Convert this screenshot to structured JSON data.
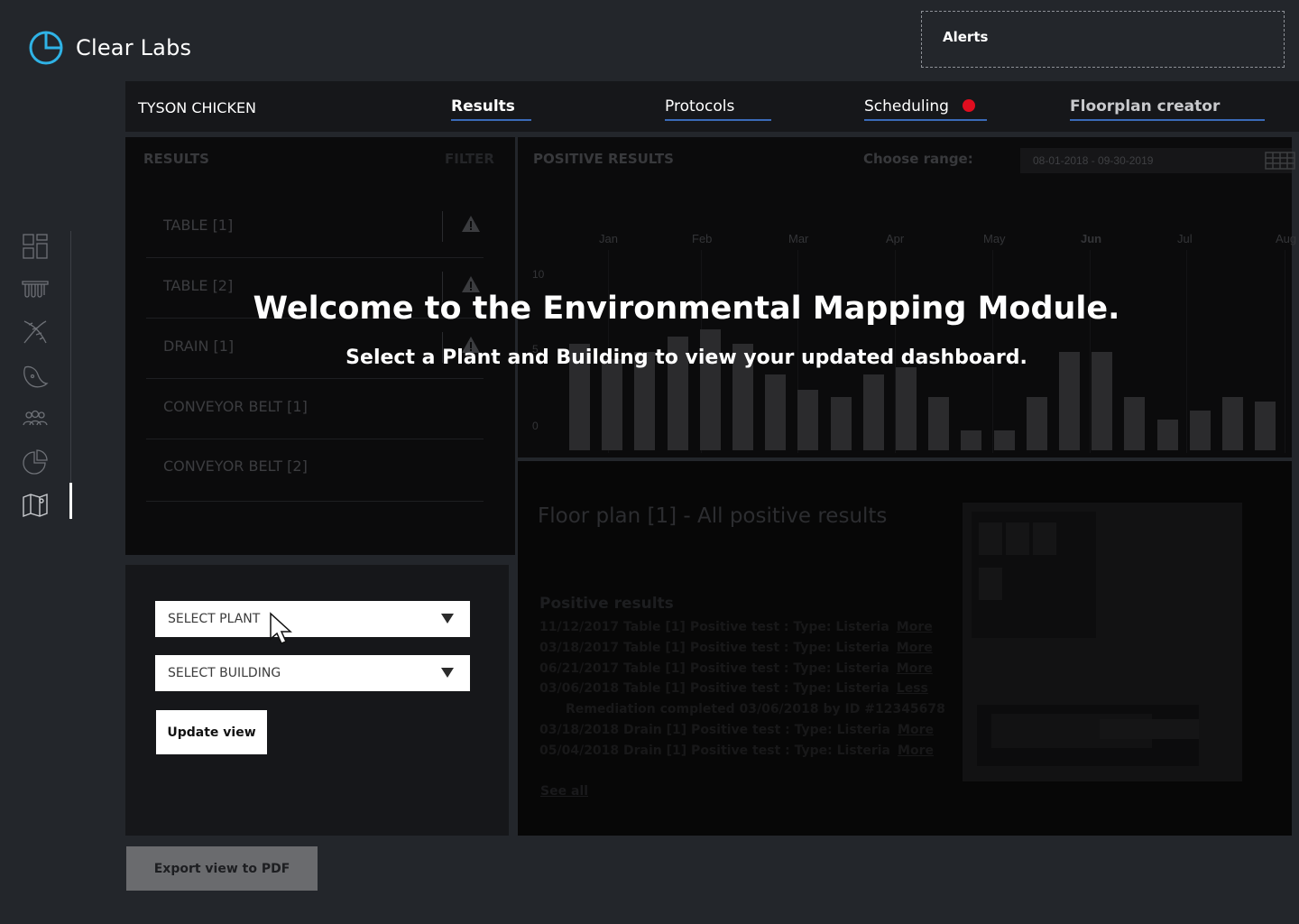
{
  "brand": {
    "name": "Clear Labs"
  },
  "alerts": {
    "label": "Alerts"
  },
  "sidebar": {
    "icons": [
      "dashboard-icon",
      "test-tubes-icon",
      "dna-icon",
      "pathogen-icon",
      "users-icon",
      "pie-chart-icon",
      "map-icon"
    ]
  },
  "topbar": {
    "client": "TYSON CHICKEN",
    "tabs": [
      {
        "label": "Results"
      },
      {
        "label": "Protocols"
      },
      {
        "label": "Scheduling"
      },
      {
        "label": "Floorplan creator"
      }
    ]
  },
  "results_panel": {
    "title": "RESULTS",
    "filter": "FILTER",
    "items": [
      "TABLE [1]",
      "TABLE [2]",
      "DRAIN [1]",
      "CONVEYOR BELT [1]",
      "CONVEYOR BELT [2]"
    ]
  },
  "chart_panel": {
    "title": "POSITIVE RESULTS",
    "range_label": "Choose range:",
    "range_value": "08-01-2018 - 09-30-2019"
  },
  "chart_data": {
    "type": "bar",
    "title": "",
    "xlabel": "",
    "ylabel": "",
    "ylim": [
      0,
      10
    ],
    "yticks": [
      "10",
      "5",
      "0"
    ],
    "months": [
      "Jan",
      "Feb",
      "Mar",
      "Apr",
      "May",
      "Jun",
      "Jul",
      "Aug"
    ],
    "values": [
      7,
      6,
      6.5,
      7.5,
      8,
      7,
      5,
      4,
      3.5,
      5,
      5.5,
      3.5,
      1.3,
      1.3,
      3.5,
      6.5,
      6.5,
      3.5,
      2,
      2.6,
      3.5,
      3.2
    ],
    "colors": {
      "bar": "#2b2b2d"
    }
  },
  "floor_panel": {
    "title": "Floor plan [1] - All positive results",
    "subtitle": "Positive results",
    "rows": [
      {
        "text": "11/12/2017 Table [1]   Positive test : Type: Listeria",
        "link": "More"
      },
      {
        "text": "03/18/2017 Table [1]   Positive test : Type: Listeria",
        "link": "More"
      },
      {
        "text": "06/21/2017 Table [1]   Positive test : Type: Listeria",
        "link": "More"
      },
      {
        "text": "03/06/2018 Table [1]   Positive test : Type: Listeria",
        "link": "Less"
      },
      {
        "text": "Remediation completed 03/06/2018 by ID #12345678",
        "link": ""
      },
      {
        "text": "03/18/2018 Drain [1]   Positive test : Type: Listeria",
        "link": "More"
      },
      {
        "text": "05/04/2018 Drain [1]   Positive test : Type: Listeria",
        "link": "More"
      }
    ],
    "see_all": "See all"
  },
  "select_panel": {
    "plant_placeholder": "SELECT PLANT",
    "building_placeholder": "SELECT BUILDING",
    "update_label": "Update view"
  },
  "export": {
    "label": "Export view to PDF"
  },
  "overlay": {
    "title": "Welcome to the Environmental Mapping Module.",
    "subtitle": "Select a Plant and Building to view your updated dashboard."
  },
  "colors": {
    "accent": "#3a6ab8",
    "alert_dot": "#e00d1f",
    "logo": "#2fb3e6"
  }
}
